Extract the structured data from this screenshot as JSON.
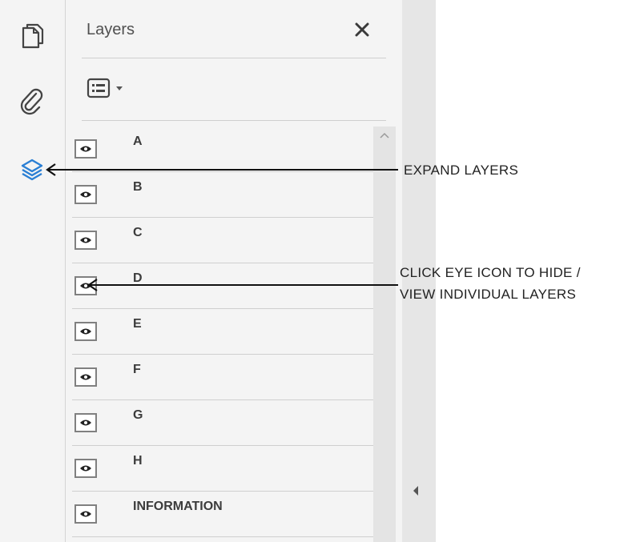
{
  "panel": {
    "title": "Layers",
    "layers": [
      "A",
      "B",
      "C",
      "D",
      "E",
      "F",
      "G",
      "H",
      "INFORMATION"
    ]
  },
  "annotations": {
    "expand": "EXPAND LAYERS",
    "eye_line1": "CLICK EYE ICON TO HIDE /",
    "eye_line2": "VIEW INDIVIDUAL LAYERS"
  },
  "icons": {
    "rail": [
      "pages-icon",
      "attachment-icon",
      "layers-icon"
    ],
    "layers_icon_color": "#2a7fd4"
  }
}
